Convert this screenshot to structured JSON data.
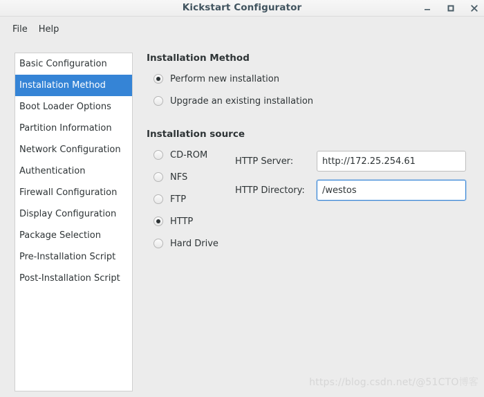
{
  "window": {
    "title": "Kickstart Configurator",
    "controls": [
      {
        "name": "minimize-button",
        "glyph": "–"
      },
      {
        "name": "maximize-button",
        "glyph": "□"
      },
      {
        "name": "close-button",
        "glyph": "✕"
      }
    ]
  },
  "menubar": {
    "items": [
      {
        "label": "File"
      },
      {
        "label": "Help"
      }
    ]
  },
  "sidebar": {
    "items": [
      {
        "label": "Basic Configuration",
        "selected": false
      },
      {
        "label": "Installation Method",
        "selected": true
      },
      {
        "label": "Boot Loader Options",
        "selected": false
      },
      {
        "label": "Partition Information",
        "selected": false
      },
      {
        "label": "Network Configuration",
        "selected": false
      },
      {
        "label": "Authentication",
        "selected": false
      },
      {
        "label": "Firewall Configuration",
        "selected": false
      },
      {
        "label": "Display Configuration",
        "selected": false
      },
      {
        "label": "Package Selection",
        "selected": false
      },
      {
        "label": "Pre-Installation Script",
        "selected": false
      },
      {
        "label": "Post-Installation Script",
        "selected": false
      }
    ]
  },
  "main": {
    "method_section": {
      "title": "Installation Method",
      "options": [
        {
          "label": "Perform new installation",
          "selected": true
        },
        {
          "label": "Upgrade an existing installation",
          "selected": false
        }
      ]
    },
    "source_section": {
      "title": "Installation source",
      "options": [
        {
          "label": "CD-ROM",
          "selected": false
        },
        {
          "label": "NFS",
          "selected": false
        },
        {
          "label": "FTP",
          "selected": false
        },
        {
          "label": "HTTP",
          "selected": true
        },
        {
          "label": "Hard Drive",
          "selected": false
        }
      ],
      "fields": [
        {
          "label": "HTTP Server:",
          "value": "http://172.25.254.61",
          "placeholder": "",
          "focused": false
        },
        {
          "label": "HTTP Directory:",
          "value": "/westos",
          "placeholder": "",
          "focused": true
        }
      ]
    }
  },
  "watermark": {
    "url": "https://blog.csdn.net/@51CTO",
    "suffix": "博客"
  },
  "colors": {
    "accent": "#3584d6",
    "titlebar_text": "#41545f",
    "background": "#ececec",
    "panel": "#ffffff",
    "text": "#2e3436"
  }
}
